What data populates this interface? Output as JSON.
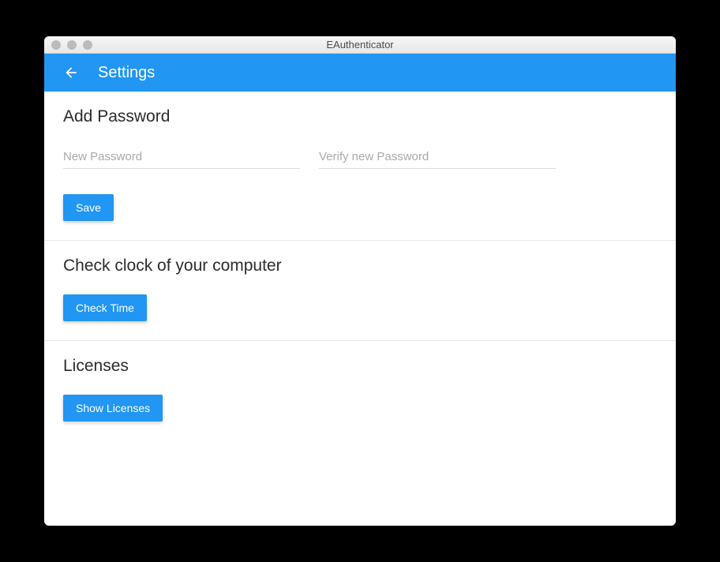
{
  "window": {
    "title": "EAuthenticator"
  },
  "header": {
    "title": "Settings"
  },
  "sections": {
    "password": {
      "title": "Add Password",
      "newPasswordPlaceholder": "New Password",
      "verifyPasswordPlaceholder": "Verify new Password",
      "saveLabel": "Save"
    },
    "clock": {
      "title": "Check clock of your computer",
      "checkTimeLabel": "Check Time"
    },
    "licenses": {
      "title": "Licenses",
      "showLicensesLabel": "Show Licenses"
    }
  }
}
